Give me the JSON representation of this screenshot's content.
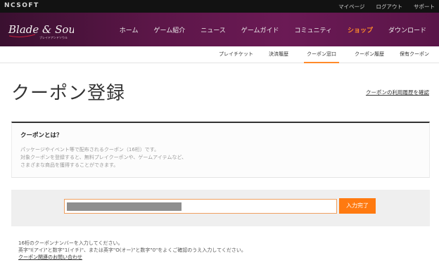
{
  "topbar": {
    "brand": "NCSOFT",
    "links": [
      "マイページ",
      "ログアウト",
      "サポート"
    ]
  },
  "header": {
    "logo_text": "Blade & Soul",
    "nav": [
      "ホーム",
      "ゲーム紹介",
      "ニュース",
      "ゲームガイド",
      "コミュニティ",
      "ショップ",
      "ダウンロード"
    ],
    "active_nav": "ショップ"
  },
  "subnav": {
    "items": [
      "プレイチケット",
      "決済履歴",
      "クーポン窓口",
      "クーポン履歴",
      "保有クーポン"
    ],
    "active": "クーポン窓口"
  },
  "page": {
    "title": "クーポン登録",
    "history_link": "クーポンの利用履歴を確認"
  },
  "info": {
    "heading": "クーポンとは？",
    "lines": [
      "パッケージやイベント等で配布されるクーポン（16桁）です。",
      "対象クーポンを登録すると、無料プレイクーポンや、ゲームアイテムなど、",
      "さまざまな商品を獲得することができます。"
    ]
  },
  "entry": {
    "input_value": "",
    "submit_label": "入力完了"
  },
  "notes": {
    "lines": [
      "16桁のクーポンナンバーを入力してください。",
      "英字\"I(アイ)\"と数字\"1(イチ)\"、または英字\"O(オー)\"と数字\"0\"をよくご確認のうえ入力してください。"
    ],
    "contact_link": "クーポン関連のお問い合わせ"
  },
  "colors": {
    "accent": "#ff7a10",
    "header_bg": "#5c1648",
    "topbar_bg": "#121212"
  }
}
